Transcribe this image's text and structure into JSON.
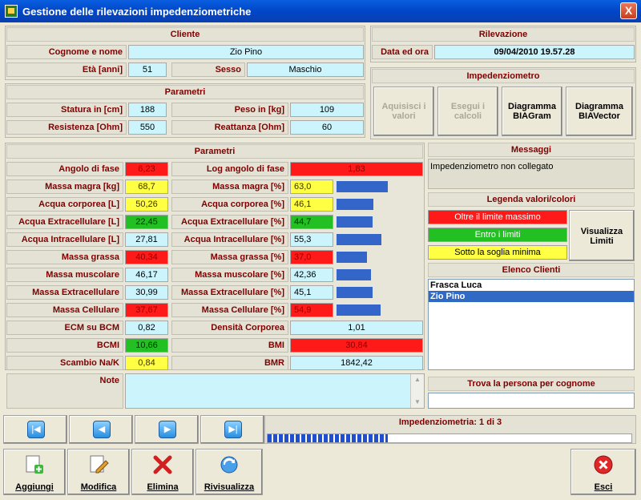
{
  "window": {
    "title": "Gestione delle rilevazioni impedenziometriche",
    "close": "X"
  },
  "cliente": {
    "header": "Cliente",
    "nome_label": "Cognome e nome",
    "nome": "Zio Pino",
    "eta_label": "Età [anni]",
    "eta": "51",
    "sesso_label": "Sesso",
    "sesso": "Maschio"
  },
  "rilevazione": {
    "header": "Rilevazione",
    "data_label": "Data ed ora",
    "data": "09/04/2010 19.57.28"
  },
  "parametri_top": {
    "header": "Parametri",
    "statura_label": "Statura in [cm]",
    "statura": "188",
    "peso_label": "Peso in [kg]",
    "peso": "109",
    "resistenza_label": "Resistenza [Ohm]",
    "resistenza": "550",
    "reattanza_label": "Reattanza [Ohm]",
    "reattanza": "60"
  },
  "impedenziometro": {
    "header": "Impedenziometro",
    "acquisisci": "Aquisisci i valori",
    "esegui": "Esegui i calcoli",
    "biagram": "Diagramma BIAGram",
    "biavector": "Diagramma BIAVector"
  },
  "parametri": {
    "header": "Parametri",
    "rows": [
      {
        "l1": "Angolo di fase",
        "v1": "6,23",
        "c1": "red",
        "l2": "Log angolo di fase",
        "v2": "1,83",
        "c2": "red",
        "bar": null
      },
      {
        "l1": "Massa magra [kg]",
        "v1": "68,7",
        "c1": "yel",
        "l2": "Massa magra [%]",
        "v2": "63,0",
        "c2": "yel",
        "bar": 0.59
      },
      {
        "l1": "Acqua corporea [L]",
        "v1": "50,26",
        "c1": "yel",
        "l2": "Acqua corporea [%]",
        "v2": "46,1",
        "c2": "yel",
        "bar": 0.43
      },
      {
        "l1": "Acqua Extracellulare [L]",
        "v1": "22,45",
        "c1": "grn",
        "l2": "Acqua Extracellulare [%]",
        "v2": "44,7",
        "c2": "grn",
        "bar": 0.42
      },
      {
        "l1": "Acqua Intracellulare [L]",
        "v1": "27,81",
        "c1": "",
        "l2": "Acqua Intracellulare [%]",
        "v2": "55,3",
        "c2": "",
        "bar": 0.52
      },
      {
        "l1": "Massa grassa",
        "v1": "40,34",
        "c1": "red",
        "l2": "Massa grassa [%]",
        "v2": "37,0",
        "c2": "red",
        "bar": 0.35
      },
      {
        "l1": "Massa muscolare",
        "v1": "46,17",
        "c1": "",
        "l2": "Massa muscolare [%]",
        "v2": "42,36",
        "c2": "",
        "bar": 0.4
      },
      {
        "l1": "Massa Extracellulare",
        "v1": "30,99",
        "c1": "",
        "l2": "Massa Extracellulare [%]",
        "v2": "45,1",
        "c2": "",
        "bar": 0.42
      },
      {
        "l1": "Massa Cellulare",
        "v1": "37,67",
        "c1": "red",
        "l2": "Massa Cellulare [%]",
        "v2": "54,9",
        "c2": "red",
        "bar": 0.51
      },
      {
        "l1": "ECM su BCM",
        "v1": "0,82",
        "c1": "",
        "l2": "Densità Corporea",
        "v2": "1,01",
        "c2": "",
        "bar": null
      },
      {
        "l1": "BCMI",
        "v1": "10,66",
        "c1": "grn",
        "l2": "BMI",
        "v2": "30,84",
        "c2": "red",
        "bar": null
      },
      {
        "l1": "Scambio Na/K",
        "v1": "0,84",
        "c1": "yel",
        "l2": "BMR",
        "v2": "1842,42",
        "c2": "",
        "bar": null
      }
    ]
  },
  "note": {
    "label": "Note",
    "text": ""
  },
  "messaggi": {
    "header": "Messaggi",
    "text": "Impedenziometro non collegato"
  },
  "legenda": {
    "header": "Legenda valori/colori",
    "max": "Oltre il limite massimo",
    "entro": "Entro i limiti",
    "min": "Sotto la soglia minima",
    "visualizza": "Visualizza Limiti",
    "colors": {
      "max": "#ff1a1a",
      "entro": "#22c022",
      "min": "#ffff44"
    }
  },
  "elenco": {
    "header": "Elenco Clienti",
    "items": [
      "Frasca Luca",
      "Zio Pino"
    ],
    "selected": 1
  },
  "trova": {
    "header": "Trova la persona per cognome",
    "value": ""
  },
  "status": {
    "text": "Impedenziometria: 1 di 3",
    "progress": 0.33
  },
  "toolbar": {
    "aggiungi": "Aggiungi",
    "modifica": "Modifica",
    "elimina": "Elimina",
    "rivisualizza": "Rivisualizza",
    "esci": "Esci"
  },
  "nav": {
    "first": "first-record-icon",
    "prev": "previous-record-icon",
    "next": "next-record-icon",
    "last": "last-record-icon"
  }
}
